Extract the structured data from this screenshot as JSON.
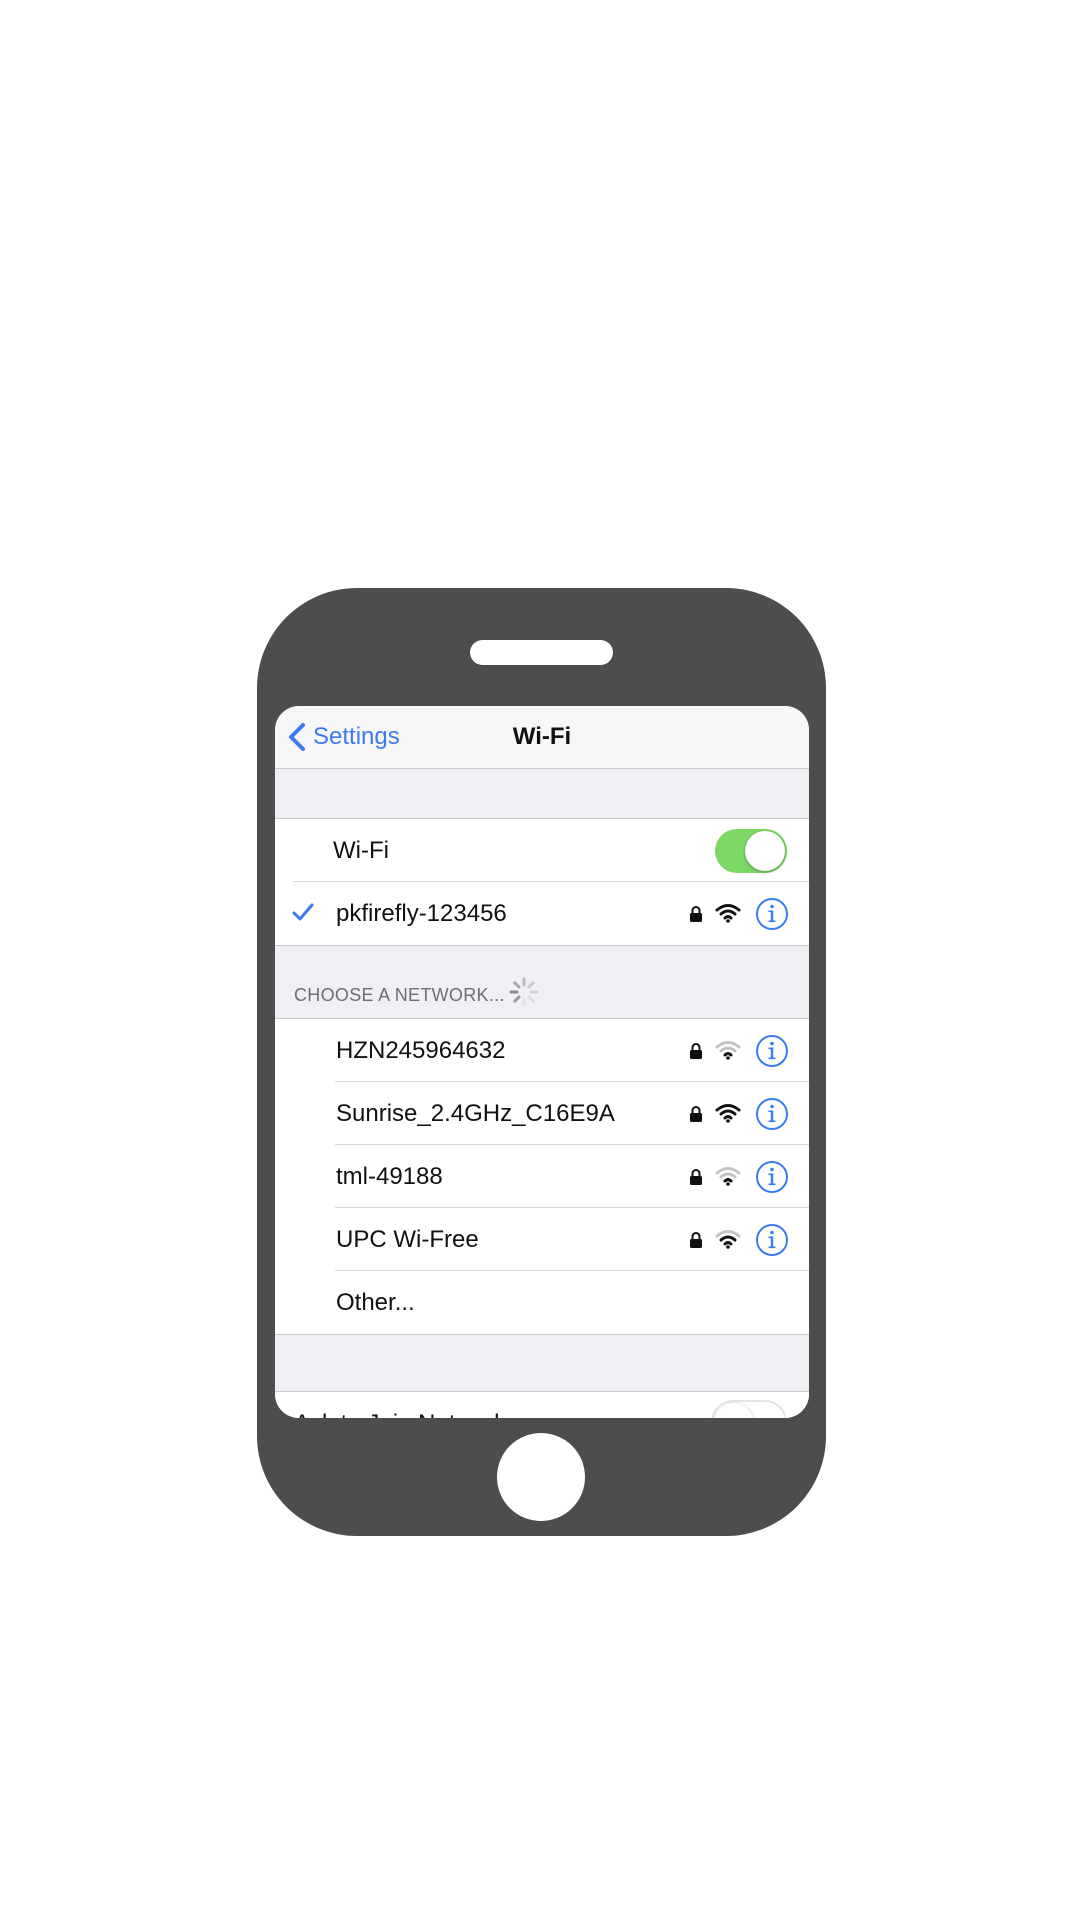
{
  "navbar": {
    "back_label": "Settings",
    "title": "Wi-Fi"
  },
  "wifi": {
    "label": "Wi-Fi",
    "enabled": true,
    "toggle_color": "#7dd865"
  },
  "connected_network": {
    "name": "pkfirefly-123456",
    "secured": true,
    "signal": "full"
  },
  "section_header": "CHOOSE A NETWORK...",
  "networks": [
    {
      "name": "HZN245964632",
      "secured": true,
      "signal": "weak"
    },
    {
      "name": "Sunrise_2.4GHz_C16E9A",
      "secured": true,
      "signal": "full"
    },
    {
      "name": "tml-49188",
      "secured": true,
      "signal": "weak"
    },
    {
      "name": "UPC Wi-Free",
      "secured": true,
      "signal": "medium"
    }
  ],
  "other_label": "Other...",
  "ask_to_join": {
    "label": "Ask to Join Networks",
    "enabled": false
  },
  "colors": {
    "accent": "#3b7bf0",
    "phone_body": "#4d4d4d",
    "toggle_on": "#7dd865",
    "grouped_background": "#efeff4"
  },
  "icons": {
    "back": "chevron-left-icon",
    "check": "checkmark-icon",
    "lock": "lock-icon",
    "wifi": "wifi-signal-icon",
    "info": "info-circle-icon",
    "spinner": "loading-spinner-icon"
  }
}
